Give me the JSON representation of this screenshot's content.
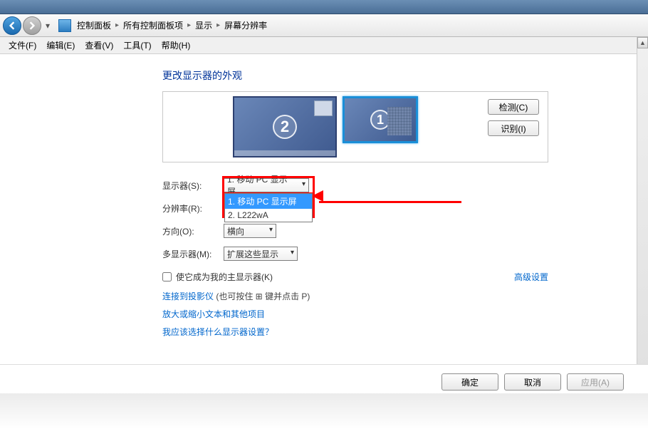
{
  "breadcrumb": {
    "p1": "控制面板",
    "p2": "所有控制面板项",
    "p3": "显示",
    "p4": "屏幕分辨率"
  },
  "menu": {
    "file": "文件(F)",
    "edit": "编辑(E)",
    "view": "查看(V)",
    "tools": "工具(T)",
    "help": "帮助(H)"
  },
  "heading": "更改显示器的外观",
  "preview": {
    "monitor1_num": "1",
    "monitor2_num": "2"
  },
  "buttons": {
    "detect": "检测(C)",
    "identify": "识别(I)",
    "ok": "确定",
    "cancel": "取消",
    "apply": "应用(A)"
  },
  "labels": {
    "display": "显示器(S):",
    "resolution": "分辨率(R):",
    "orientation": "方向(O):",
    "multi": "多显示器(M):"
  },
  "values": {
    "display_selected": "1. 移动 PC 显示屏",
    "resolution_hidden": "",
    "orientation": "横向",
    "multi": "扩展这些显示"
  },
  "dropdown": {
    "opt1": "1. 移动 PC 显示屏",
    "opt2": "2. L222wA"
  },
  "checkbox": "使它成为我的主显示器(K)",
  "advanced": "高级设置",
  "links": {
    "projector_pre": "连接到投影仪",
    "projector_hint": " (也可按住 ⊞ 键并点击 P)",
    "text_size": "放大或缩小文本和其他项目",
    "which": "我应该选择什么显示器设置？"
  }
}
